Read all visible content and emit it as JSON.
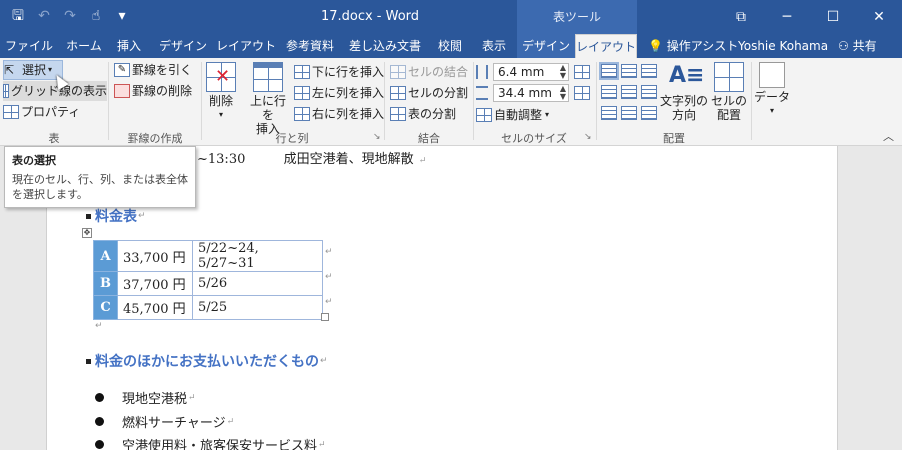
{
  "titlebar": {
    "document_title": "17.docx - Word",
    "context_tools": "表ツール",
    "qat_save": "🖫",
    "qat_undo": "↶",
    "qat_redo": "↷",
    "qat_touch": "☝",
    "qat_more": "▾",
    "win_restore": "⧉",
    "win_minimize": "─",
    "win_maximize": "☐",
    "win_close": "✕"
  },
  "tabs": {
    "file": "ファイル",
    "home": "ホーム",
    "insert": "挿入",
    "design": "デザイン",
    "layout": "レイアウト",
    "references": "参考資料",
    "mailings": "差し込み文書",
    "review": "校閲",
    "view": "表示",
    "table_design": "デザイン",
    "table_layout": "レイアウト",
    "tell_me": "操作アシスト",
    "user": "Yoshie Kohama",
    "share": "共有"
  },
  "ribbon": {
    "table": {
      "select": "選択",
      "gridlines": "グリッド線の表示",
      "properties": "プロパティ",
      "label": "表"
    },
    "draw": {
      "draw_table": "罫線を引く",
      "eraser": "罫線の削除",
      "label": "罫線の作成"
    },
    "rows_cols": {
      "delete": "削除",
      "insert_above_1": "上に行を",
      "insert_above_2": "挿入",
      "insert_below": "下に行を挿入",
      "insert_left": "左に列を挿入",
      "insert_right": "右に列を挿入",
      "label": "行と列"
    },
    "merge": {
      "merge_cells": "セルの結合",
      "split_cells": "セルの分割",
      "split_table": "表の分割",
      "label": "結合"
    },
    "cell_size": {
      "height": "6.4 mm",
      "width": "34.4 mm",
      "autofit": "自動調整",
      "label": "セルのサイズ"
    },
    "alignment": {
      "text_direction_1": "文字列の",
      "text_direction_2": "方向",
      "cell_margins_1": "セルの",
      "cell_margins_2": "配置",
      "label": "配置"
    },
    "data": {
      "data": "データ"
    }
  },
  "tooltip": {
    "title": "表の選択",
    "body_1": "現在のセル、行、列、または表全体",
    "body_2": "を選択します。"
  },
  "document": {
    "line1_time": "~13:30",
    "line1_text": "成田空港着、現地解散",
    "heading_fee": "料金表",
    "table_rows": [
      {
        "key": "A",
        "price": "33,700 円",
        "dates": "5/22~24, 5/27~31"
      },
      {
        "key": "B",
        "price": "37,700 円",
        "dates": "5/26"
      },
      {
        "key": "C",
        "price": "45,700 円",
        "dates": "5/25"
      }
    ],
    "heading_other": "料金のほかにお支払いいただくもの",
    "bullets": [
      "現地空港税",
      "燃料サーチャージ",
      "空港使用料・旅客保安サービス料"
    ],
    "para_mark": "↵",
    "move_handle": "✥"
  }
}
